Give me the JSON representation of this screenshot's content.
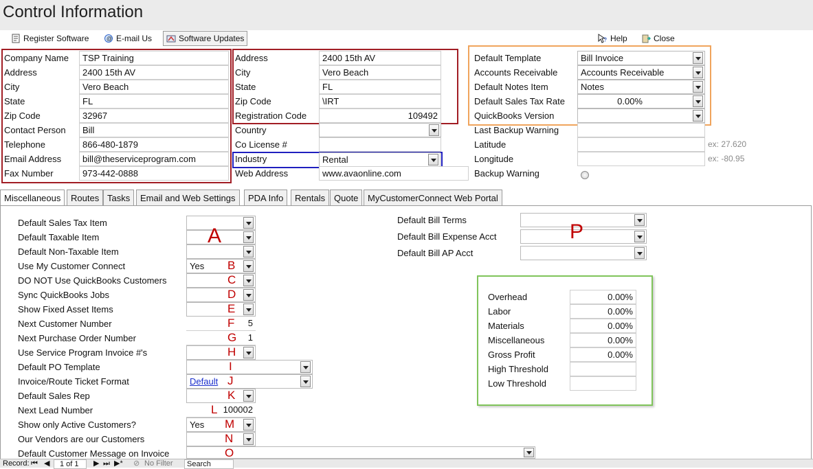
{
  "form": {
    "title": "Control Information"
  },
  "toolbar": {
    "register": "Register Software",
    "email": "E-mail Us",
    "updates": "Software Updates",
    "help": "Help",
    "close": "Close"
  },
  "company": {
    "name_label": "Company Name",
    "name": "TSP Training",
    "address_label": "Address",
    "address": "2400 15th AV",
    "city_label": "City",
    "city": "Vero Beach",
    "state_label": "State",
    "state": "FL",
    "zip_label": "Zip Code",
    "zip": "32967",
    "contact_label": "Contact Person",
    "contact": "Bill",
    "phone_label": "Telephone",
    "phone": "866-480-1879",
    "email_label": "Email Address",
    "email": "bill@theserviceprogram.com",
    "fax_label": "Fax Number",
    "fax": "973-442-0888"
  },
  "registration": {
    "address_label": "Address",
    "address": "2400 15th AV",
    "city_label": "City",
    "city": "Vero Beach",
    "state_label": "State",
    "state": "FL",
    "zip_label": "Zip Code",
    "zip": "\\IRT",
    "code_label": "Registration Code",
    "code": "109492",
    "country_label": "Country",
    "country": "",
    "license_label": "Co License #",
    "license": "",
    "industry_label": "Industry",
    "industry": "Rental",
    "web_label": "Web Address",
    "web": "www.avaonline.com"
  },
  "defaults": {
    "template_label": "Default Template",
    "template": "Bill Invoice",
    "ar_label": "Accounts Receivable",
    "ar": "Accounts Receivable",
    "notes_label": "Default Notes Item",
    "notes": "Notes",
    "tax_label": "Default Sales Tax Rate",
    "tax": "0.00%",
    "qb_label": "QuickBooks Version",
    "qb": "",
    "backup_warn_label": "Last Backup Warning",
    "backup_warn": "",
    "lat_label": "Latitude",
    "lat": "",
    "lat_hint": "ex: 27.620",
    "lon_label": "Longitude",
    "lon": "",
    "lon_hint": "ex: -80.95",
    "backup_label": "Backup Warning"
  },
  "tabs": [
    "Miscellaneous",
    "Routes",
    "Tasks",
    "Email and Web Settings",
    "PDA Info",
    "Rentals",
    "Quote",
    "MyCustomerConnect Web Portal"
  ],
  "misc": {
    "rows": [
      {
        "label": "Default Sales Tax Item",
        "value": ""
      },
      {
        "label": "Default Taxable Item",
        "value": ""
      },
      {
        "label": "Default Non-Taxable Item",
        "value": ""
      },
      {
        "label": "Use My Customer Connect",
        "value": "Yes"
      },
      {
        "label": "DO NOT Use QuickBooks Customers",
        "value": ""
      },
      {
        "label": "Sync QuickBooks Jobs",
        "value": ""
      },
      {
        "label": "Show Fixed Asset Items",
        "value": ""
      },
      {
        "label": "Next Customer Number",
        "value": "5"
      },
      {
        "label": "Next Purchase Order Number",
        "value": "1"
      },
      {
        "label": "Use Service Program Invoice #'s",
        "value": ""
      },
      {
        "label": "Default PO Template",
        "value": ""
      },
      {
        "label": "Invoice/Route Ticket Format",
        "value": "Default"
      },
      {
        "label": "Default Sales Rep",
        "value": ""
      },
      {
        "label": "Next Lead Number",
        "value": "100002"
      },
      {
        "label": "Show only Active Customers?",
        "value": "Yes"
      },
      {
        "label": "Our Vendors are our Customers",
        "value": ""
      },
      {
        "label": "Default Customer Message on Invoice",
        "value": ""
      }
    ],
    "letters": [
      "A",
      "B",
      "C",
      "D",
      "E",
      "F",
      "G",
      "H",
      "I",
      "J",
      "K",
      "L",
      "M",
      "N",
      "O"
    ],
    "bill_terms_label": "Default Bill Terms",
    "bill_expense_label": "Default Bill Expense Acct",
    "bill_ap_label": "Default Bill AP Acct",
    "bill_letter": "P",
    "overhead": [
      {
        "label": "Overhead",
        "value": "0.00%"
      },
      {
        "label": "Labor",
        "value": "0.00%"
      },
      {
        "label": "Materials",
        "value": "0.00%"
      },
      {
        "label": "Miscellaneous",
        "value": "0.00%"
      },
      {
        "label": "Gross Profit",
        "value": "0.00%"
      },
      {
        "label": "High Threshold",
        "value": ""
      },
      {
        "label": "Low Threshold",
        "value": ""
      }
    ]
  },
  "status": {
    "record_label": "Record:",
    "position": "1 of 1",
    "filter": "No Filter",
    "search": "Search"
  },
  "colors": {
    "red_box": "#a11d24",
    "orange_box": "#f0a45c",
    "blue_box": "#1f1fbf",
    "green_box": "#7fc45a",
    "letter": "#c00000"
  },
  "icons": [
    "register-icon",
    "email-icon",
    "updates-icon",
    "help-icon",
    "close-icon"
  ]
}
